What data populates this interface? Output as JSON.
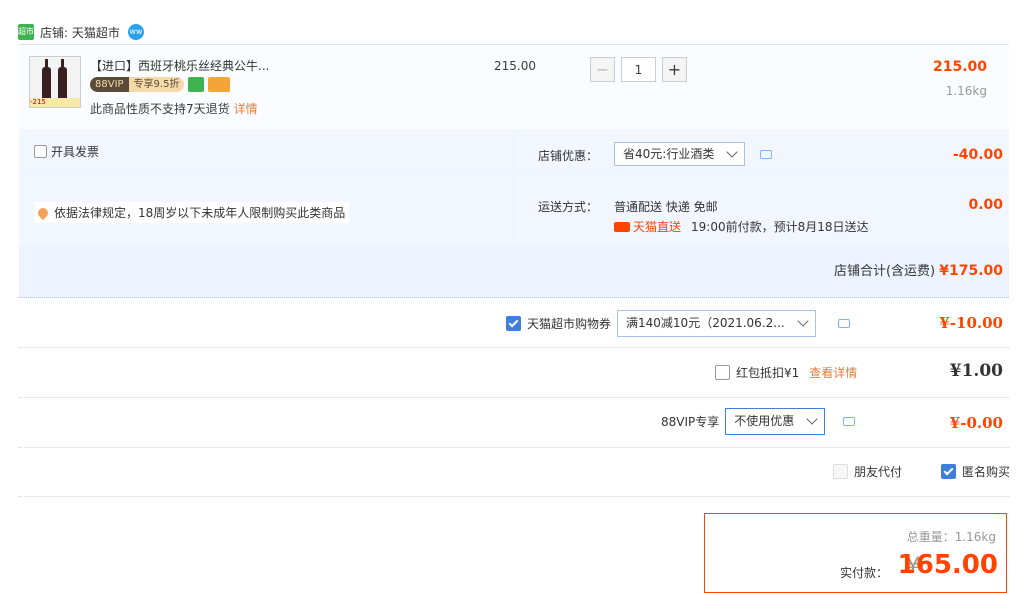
{
  "store": {
    "logo_text": "超市",
    "name": "店铺: 天猫超市",
    "ww_text": "ww"
  },
  "product": {
    "thumb_badge": "-215",
    "title": "【进口】西班牙桃乐丝经典公牛...",
    "vip_left": "88VIP",
    "vip_right": "专享9.5折",
    "policy": "此商品性质不支持7天退货",
    "detail_link": "详情",
    "unit_price": "215.00",
    "qty_minus": "−",
    "qty": "1",
    "qty_plus": "+",
    "line_total": "215.00",
    "weight": "1.16kg"
  },
  "shop": {
    "invoice_label": "开具发票",
    "law_notice": "依据法律规定，18周岁以下未成年人限制购买此类商品",
    "discount_label": "店铺优惠：",
    "discount_select": "省40元:行业酒类",
    "discount_amount": "-40.00",
    "shipping_label": "运送方式：",
    "shipping_method": "普通配送 快递 免邮",
    "shipping_amount": "0.00",
    "tmall_direct": "天猫直送",
    "delivery_note": "19:00前付款，预计8月18日送达",
    "subtotal_label": "店铺合计(含运费)",
    "subtotal_value": "¥175.00"
  },
  "coupon": {
    "label": "天猫超市购物券",
    "select": "满140减10元（2021.06.2...",
    "amount": "¥-10.00",
    "checked": true
  },
  "redpacket": {
    "label": "红包抵扣¥1",
    "link": "查看详情",
    "amount": "¥1.00"
  },
  "vip": {
    "label": "88VIP专享",
    "select": "不使用优惠",
    "amount": "¥-0.00"
  },
  "options": {
    "friend_pay": "朋友代付",
    "anonymous": "匿名购买"
  },
  "payment": {
    "total_weight": "总重量：1.16kg",
    "label": "实付款：",
    "yen": "¥",
    "amount": "165.00"
  },
  "colors": {
    "accent": "#ff4400",
    "link": "#e07e3c",
    "checkbox": "#3d7fdb"
  }
}
